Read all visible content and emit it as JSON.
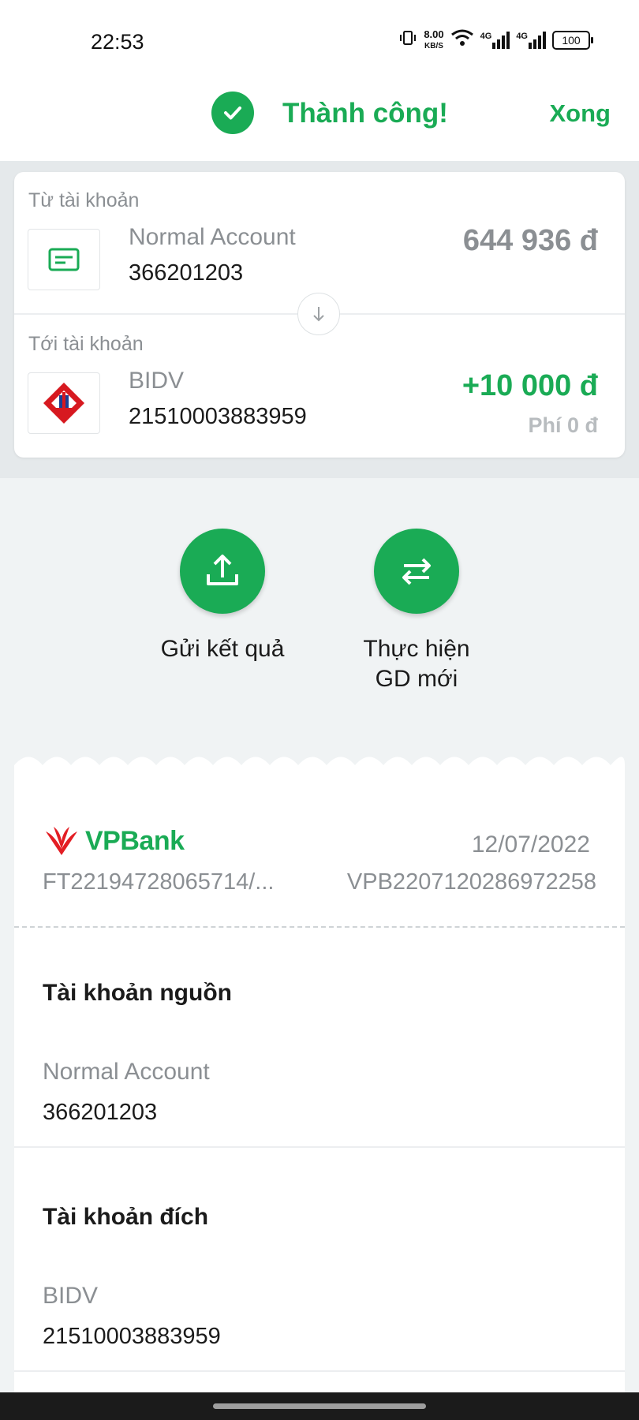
{
  "status_bar": {
    "time": "22:53",
    "net_speed_value": "8.00",
    "net_speed_unit": "KB/S",
    "signal1": "4G",
    "signal2": "4G",
    "battery": "100"
  },
  "header": {
    "title": "Thành công!",
    "done_label": "Xong",
    "accent": "#1aab55"
  },
  "summary": {
    "from_label": "Từ tài khoản",
    "from_name": "Normal Account",
    "from_number": "366201203",
    "from_amount": "644 936 đ",
    "to_label": "Tới tài khoản",
    "to_name": "BIDV",
    "to_number": "21510003883959",
    "to_amount": "+10 000 đ",
    "fee": "Phí 0 đ"
  },
  "actions": [
    {
      "label": "Gửi kết quả",
      "icon": "share-upload-icon"
    },
    {
      "label": "Thực hiện\nGD mới",
      "icon": "swap-arrows-icon"
    }
  ],
  "receipt": {
    "brand": "VPBank",
    "date": "12/07/2022",
    "ref1": "FT22194728065714/...",
    "ref2": "VPB2207120286972258",
    "source_heading": "Tài khoản nguồn",
    "source_name": "Normal Account",
    "source_number": "366201203",
    "dest_heading": "Tài khoản đích",
    "dest_name": "BIDV",
    "dest_number": "21510003883959"
  }
}
